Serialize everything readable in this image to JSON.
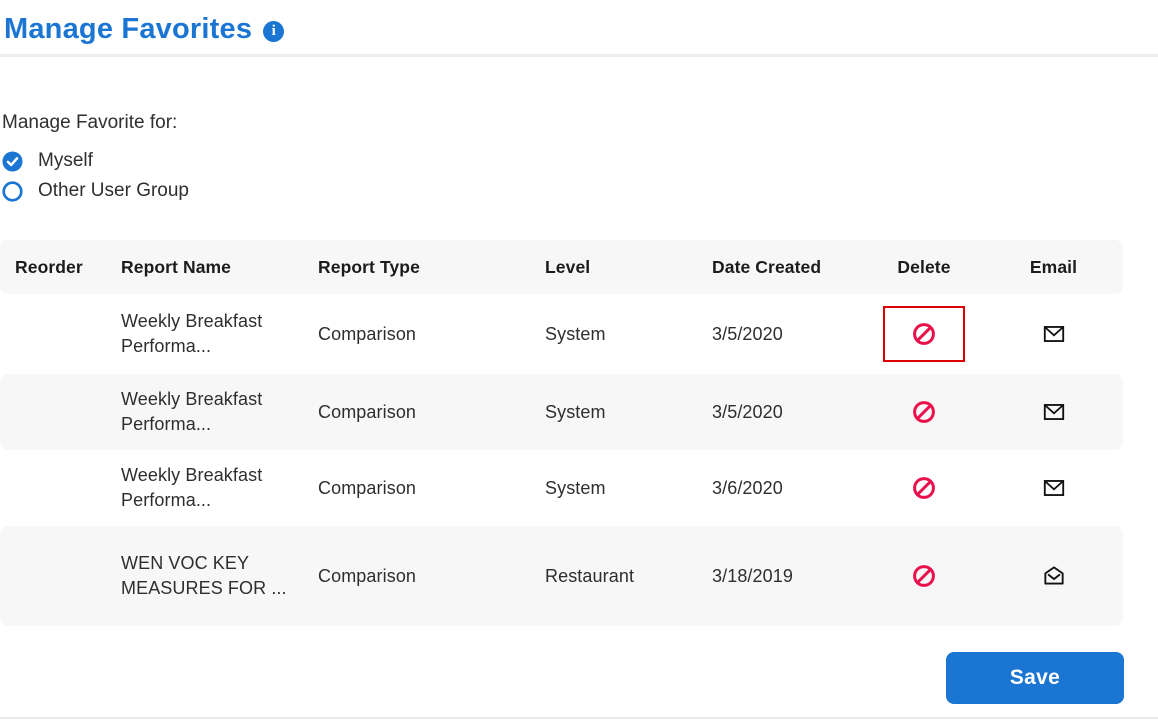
{
  "page": {
    "title": "Manage Favorites"
  },
  "icons": {
    "info": "info-icon",
    "radio_selected": "check-circle-icon",
    "radio_unselected": "circle-outline-icon",
    "delete": "no-entry-icon",
    "email_closed": "envelope-closed-icon",
    "email_open": "envelope-open-icon"
  },
  "colors": {
    "accent": "#1b75d2",
    "delete_icon": "#e8114b",
    "highlight_box": "#dd0000",
    "row_alt": "#f7f7f7"
  },
  "favorite_for": {
    "label": "Manage Favorite for:",
    "options": [
      {
        "label": "Myself",
        "selected": true
      },
      {
        "label": "Other User Group",
        "selected": false
      }
    ]
  },
  "table": {
    "columns": [
      "Reorder",
      "Report Name",
      "Report Type",
      "Level",
      "Date Created",
      "Delete",
      "Email"
    ],
    "rows": [
      {
        "reorder": "",
        "report_name": "Weekly Breakfast Performa...",
        "report_type": "Comparison",
        "level": "System",
        "date_created": "3/5/2020",
        "delete_highlighted": true,
        "email_state": "closed"
      },
      {
        "reorder": "",
        "report_name": "Weekly Breakfast Performa...",
        "report_type": "Comparison",
        "level": "System",
        "date_created": "3/5/2020",
        "delete_highlighted": false,
        "email_state": "closed"
      },
      {
        "reorder": "",
        "report_name": "Weekly Breakfast Performa...",
        "report_type": "Comparison",
        "level": "System",
        "date_created": "3/6/2020",
        "delete_highlighted": false,
        "email_state": "closed"
      },
      {
        "reorder": "",
        "report_name": "WEN VOC KEY MEASURES FOR ...",
        "report_type": "Comparison",
        "level": "Restaurant",
        "date_created": "3/18/2019",
        "delete_highlighted": false,
        "email_state": "open"
      }
    ]
  },
  "actions": {
    "save_label": "Save"
  }
}
